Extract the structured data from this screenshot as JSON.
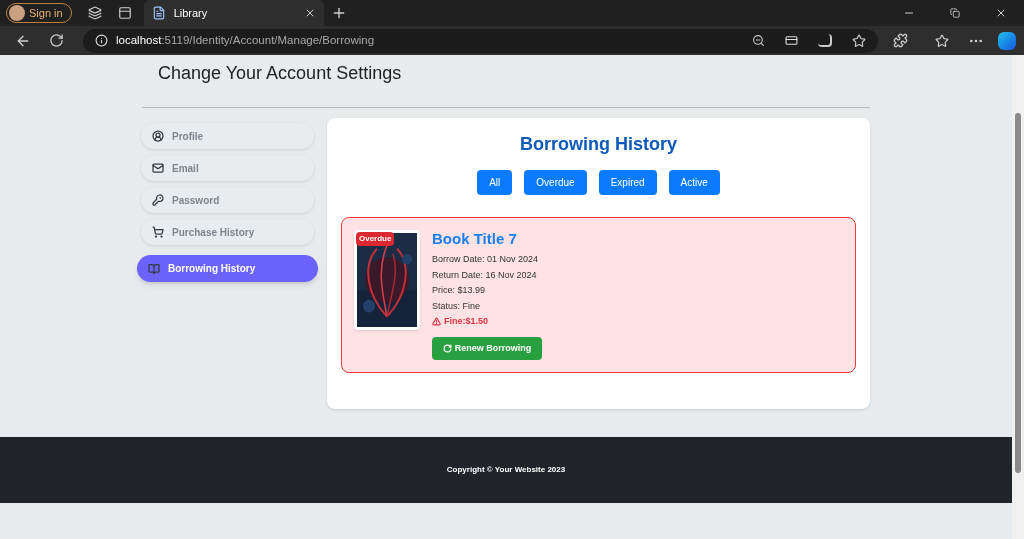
{
  "browser": {
    "profile_button": "Sign in",
    "tabs": [
      {
        "title": "Library",
        "selected": true
      }
    ],
    "url_host": "localhost",
    "url_path": ":5119/Identity/Account/Manage/Borrowing"
  },
  "page": {
    "heading": "Change Your Account Settings",
    "sidebar": {
      "items": [
        {
          "label": "Profile",
          "selected": false
        },
        {
          "label": "Email",
          "selected": false
        },
        {
          "label": "Password",
          "selected": false
        },
        {
          "label": "Purchase History",
          "selected": false
        },
        {
          "label": "Borrowing History",
          "selected": true
        }
      ]
    },
    "panel": {
      "title": "Borrowing History",
      "filters": [
        {
          "label": "All"
        },
        {
          "label": "Overdue"
        },
        {
          "label": "Expired"
        },
        {
          "label": "Active"
        }
      ],
      "loans": [
        {
          "status_badge": "Overdue",
          "overdue": true,
          "title": "Book Title 7",
          "details": [
            "Borrow Date: 01 Nov 2024",
            "Return Date: 16 Nov 2024",
            "Price: $13.99",
            "Status: Fine"
          ],
          "fine": "Fine:$1.50",
          "action": "Renew Borrowing"
        }
      ]
    }
  },
  "footer": {
    "copyright": "Copyright © Your Website 2023"
  }
}
